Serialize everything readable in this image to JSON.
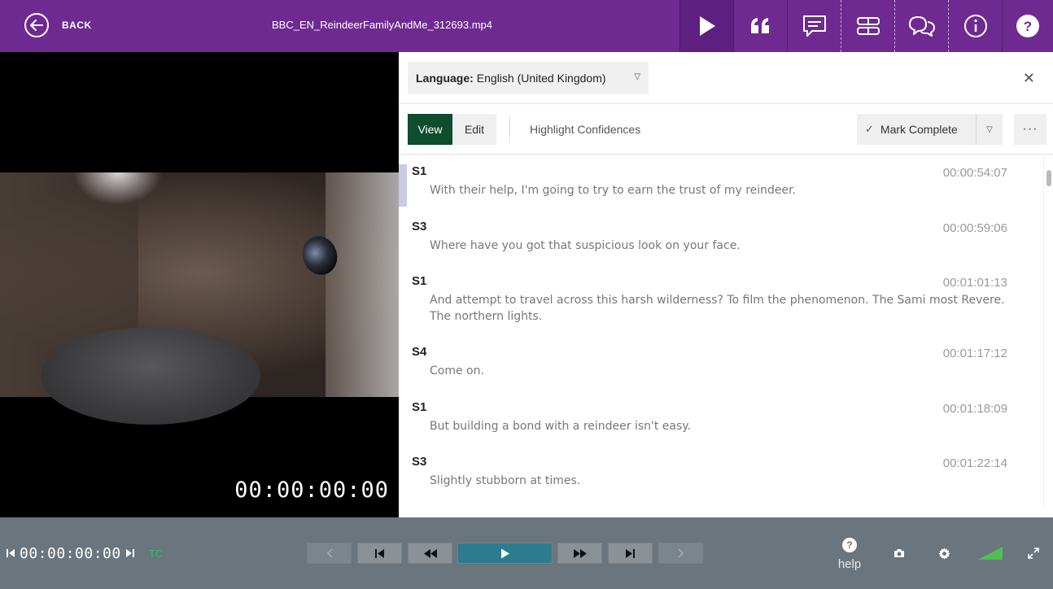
{
  "header": {
    "back_label": "BACK",
    "filename": "BBC_EN_ReindeerFamilyAndMe_312693.mp4",
    "buttons": [
      "play-icon",
      "quote-icon",
      "captions-icon",
      "layout-icon",
      "comments-icon",
      "info-icon",
      "help-icon"
    ]
  },
  "video": {
    "timecode": "00:00:00:00"
  },
  "panel": {
    "language_label": "Language:",
    "language_value": "English (United Kingdom)",
    "view_label": "View",
    "edit_label": "Edit",
    "highlight_label": "Highlight Confidences",
    "mark_complete_label": "Mark Complete",
    "more_label": "···"
  },
  "transcript": [
    {
      "speaker": "S1",
      "time": "00:00:54:07",
      "text": "With their help, I'm going to try to earn the trust of my reindeer."
    },
    {
      "speaker": "S3",
      "time": "00:00:59:06",
      "text": "Where have you got that suspicious look on your face."
    },
    {
      "speaker": "S1",
      "time": "00:01:01:13",
      "text": "And attempt to travel across this harsh wilderness? To film the phenomenon. The Sami most Revere. The northern lights."
    },
    {
      "speaker": "S4",
      "time": "00:01:17:12",
      "text": "Come on."
    },
    {
      "speaker": "S1",
      "time": "00:01:18:09",
      "text": "But building a bond with a reindeer isn't easy."
    },
    {
      "speaker": "S3",
      "time": "00:01:22:14",
      "text": "Slightly stubborn at times."
    }
  ],
  "player": {
    "timecode": "00:00:00:00",
    "tc_label": "TC",
    "help_label": "help"
  }
}
